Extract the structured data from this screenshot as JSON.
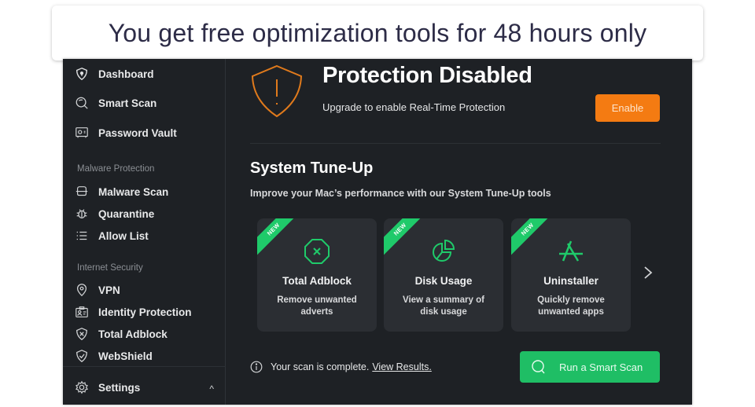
{
  "banner": {
    "text": "You get free optimization tools for 48 hours only"
  },
  "sidebar": {
    "items": [
      {
        "label": "Dashboard",
        "icon": "shield-lock-icon"
      },
      {
        "label": "Smart Scan",
        "icon": "search-icon"
      },
      {
        "label": "Password Vault",
        "icon": "vault-icon"
      }
    ],
    "sections": [
      {
        "label": "Malware Protection",
        "items": [
          {
            "label": "Malware Scan",
            "icon": "scanner-icon"
          },
          {
            "label": "Quarantine",
            "icon": "bug-icon"
          },
          {
            "label": "Allow List",
            "icon": "list-icon"
          }
        ]
      },
      {
        "label": "Internet Security",
        "items": [
          {
            "label": "VPN",
            "icon": "location-pin-icon"
          },
          {
            "label": "Identity Protection",
            "icon": "id-card-icon"
          },
          {
            "label": "Total Adblock",
            "icon": "shield-x-icon"
          },
          {
            "label": "WebShield",
            "icon": "shield-check-icon"
          }
        ]
      }
    ],
    "settings": {
      "label": "Settings",
      "icon": "gear-icon",
      "chevron": "^"
    }
  },
  "protection": {
    "title": "Protection Disabled",
    "subtitle": "Upgrade to enable Real-Time Protection",
    "enable_label": "Enable",
    "accent": "#f47b12"
  },
  "tuneup": {
    "title": "System Tune-Up",
    "subtitle": "Improve your Mac’s performance with our System Tune-Up tools",
    "badge": "NEW",
    "cards": [
      {
        "title": "Total Adblock",
        "desc": "Remove unwanted adverts",
        "icon": "octagon-x-icon"
      },
      {
        "title": "Disk Usage",
        "desc": "View a summary of disk usage",
        "icon": "pie-chart-icon"
      },
      {
        "title": "Uninstaller",
        "desc": "Quickly remove unwanted apps",
        "icon": "app-store-icon"
      }
    ],
    "accent": "#1fca6a"
  },
  "status": {
    "text": "Your scan is complete.",
    "link": "View Results.",
    "scan_button": "Run a Smart Scan"
  }
}
